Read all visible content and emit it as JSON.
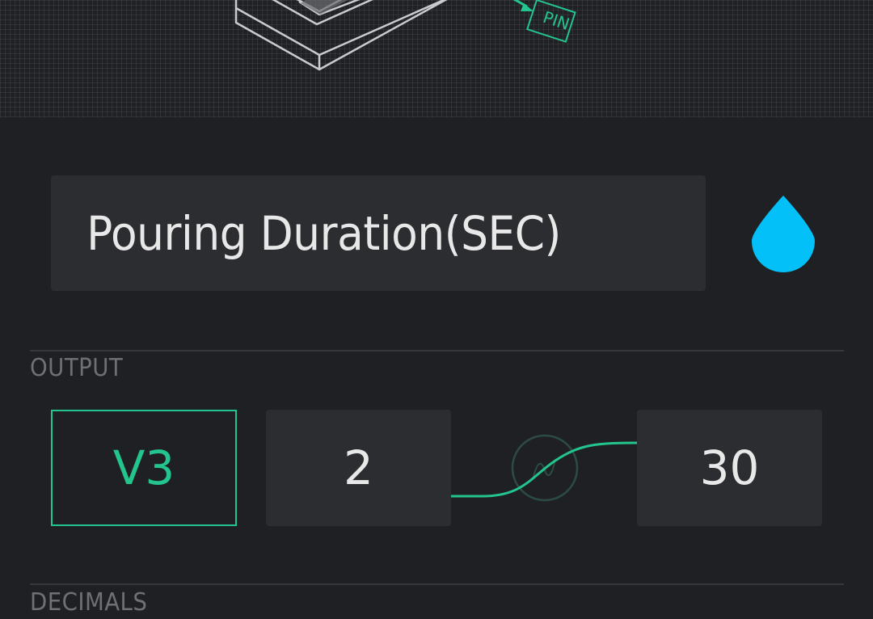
{
  "header": {
    "illustration": "device-connection-illustration",
    "pin_tag": "PIN"
  },
  "widget_name": {
    "value": "Pouring Duration(SEC)"
  },
  "color_picker": {
    "icon": "water-drop-icon",
    "color": "#04c0f8"
  },
  "output": {
    "label": "OUTPUT",
    "pin": "V3",
    "min": "2",
    "max": "30",
    "accent": "#23c48e"
  },
  "decimals": {
    "label": "DECIMALS"
  }
}
